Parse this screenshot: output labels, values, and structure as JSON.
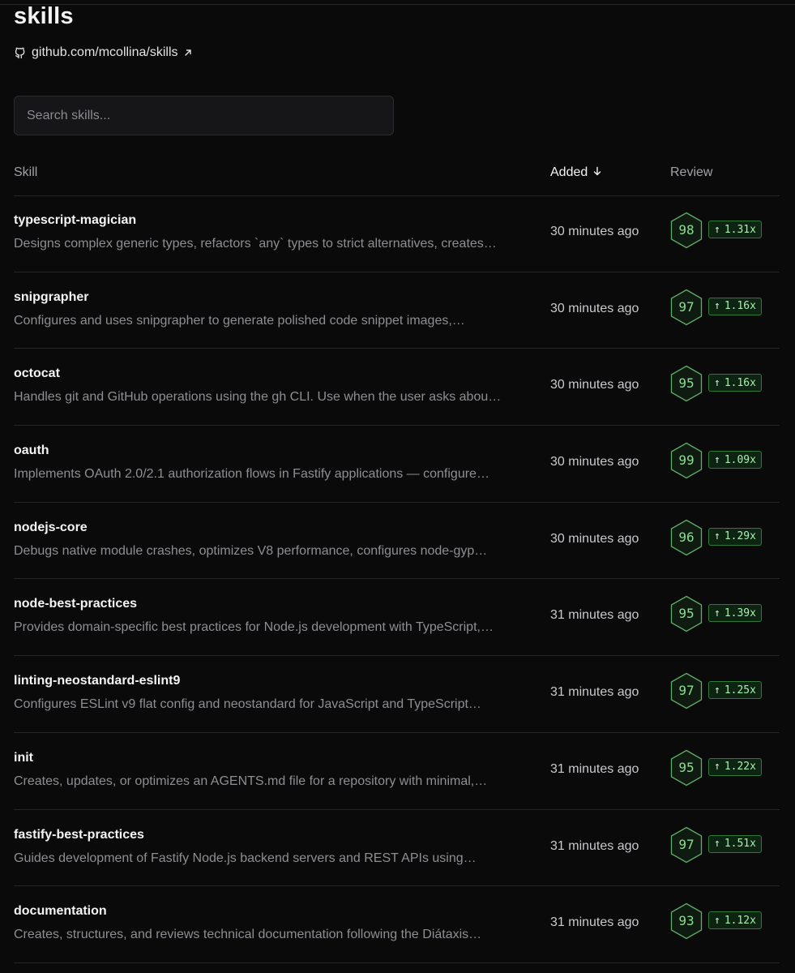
{
  "header": {
    "title": "skills",
    "repo_link": "github.com/mcollina/skills"
  },
  "search": {
    "placeholder": "Search skills..."
  },
  "table": {
    "columns": {
      "skill": "Skill",
      "added": "Added",
      "review": "Review"
    },
    "sort": "added-descending",
    "rows": [
      {
        "name": "typescript-magician",
        "description": "Designs complex generic types, refactors `any` types to strict alternatives, creates…",
        "added": "30 minutes ago",
        "score": "98",
        "multiplier": "1.31x"
      },
      {
        "name": "snipgrapher",
        "description": "Configures and uses snipgrapher to generate polished code snippet images,…",
        "added": "30 minutes ago",
        "score": "97",
        "multiplier": "1.16x"
      },
      {
        "name": "octocat",
        "description": "Handles git and GitHub operations using the gh CLI. Use when the user asks abou…",
        "added": "30 minutes ago",
        "score": "95",
        "multiplier": "1.16x"
      },
      {
        "name": "oauth",
        "description": "Implements OAuth 2.0/2.1 authorization flows in Fastify applications — configure…",
        "added": "30 minutes ago",
        "score": "99",
        "multiplier": "1.09x"
      },
      {
        "name": "nodejs-core",
        "description": "Debugs native module crashes, optimizes V8 performance, configures node-gyp…",
        "added": "30 minutes ago",
        "score": "96",
        "multiplier": "1.29x"
      },
      {
        "name": "node-best-practices",
        "description": "Provides domain-specific best practices for Node.js development with TypeScript,…",
        "added": "31 minutes ago",
        "score": "95",
        "multiplier": "1.39x"
      },
      {
        "name": "linting-neostandard-eslint9",
        "description": "Configures ESLint v9 flat config and neostandard for JavaScript and TypeScript…",
        "added": "31 minutes ago",
        "score": "97",
        "multiplier": "1.25x"
      },
      {
        "name": "init",
        "description": "Creates, updates, or optimizes an AGENTS.md file for a repository with minimal,…",
        "added": "31 minutes ago",
        "score": "95",
        "multiplier": "1.22x"
      },
      {
        "name": "fastify-best-practices",
        "description": "Guides development of Fastify Node.js backend servers and REST APIs using…",
        "added": "31 minutes ago",
        "score": "97",
        "multiplier": "1.51x"
      },
      {
        "name": "documentation",
        "description": "Creates, structures, and reviews technical documentation following the Diátaxis…",
        "added": "31 minutes ago",
        "score": "93",
        "multiplier": "1.12x"
      }
    ]
  },
  "colors": {
    "background": "#0a0a0b",
    "accent_green": "#86e08e",
    "badge_bg": "#0e2412",
    "badge_border": "#2f7a38"
  },
  "icons": {
    "repo": "github-icon",
    "external": "external-link-icon",
    "sort": "arrow-down-icon",
    "score": "hexagon-icon",
    "trend": "arrow-up-icon"
  }
}
